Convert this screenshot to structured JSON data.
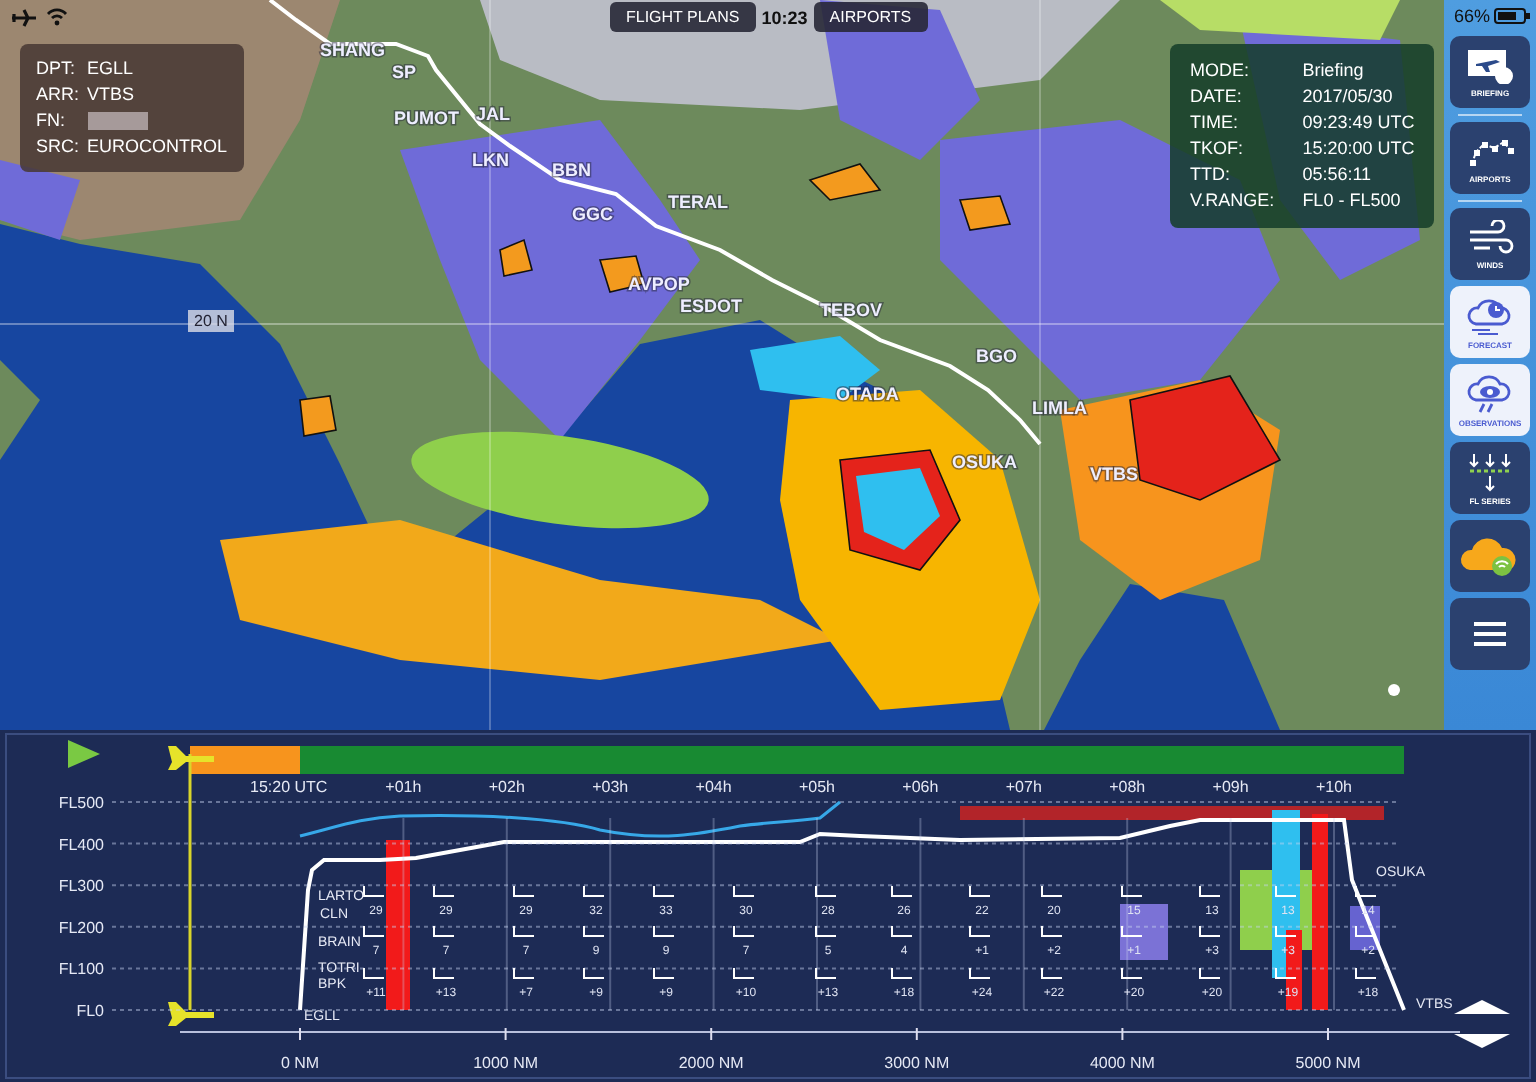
{
  "status_bar": {
    "time": "10:23",
    "battery": "66%"
  },
  "top_buttons": [
    {
      "label": "FLIGHT PLANS",
      "selected": false
    },
    {
      "label": "AIRPORTS",
      "selected": false
    }
  ],
  "flight_info": [
    {
      "label": "DPT:",
      "value": "EGLL"
    },
    {
      "label": "ARR:",
      "value": "VTBS"
    },
    {
      "label": "FN:",
      "redacted": true
    },
    {
      "label": "SRC:",
      "value": "EUROCONTROL"
    }
  ],
  "briefing_info": [
    {
      "label": "MODE:",
      "value": "Briefing"
    },
    {
      "label": "DATE:",
      "value": "2017/05/30"
    },
    {
      "label": "TIME:",
      "value": "09:23:49 UTC"
    },
    {
      "label": "TKOF:",
      "value": "15:20:00 UTC"
    },
    {
      "label": "TTD:",
      "value": "05:56:11"
    },
    {
      "label": "V.RANGE:",
      "value": "FL0 - FL500"
    }
  ],
  "map": {
    "latitude_label": "20 N",
    "waypoints": [
      "SHANG",
      "SP",
      "PUMOT",
      "JAL",
      "LKN",
      "BBN",
      "GGC",
      "TERAL",
      "AVPOP",
      "ESDOT",
      "TEBOV",
      "OTADA",
      "BGO",
      "LIMLA",
      "OSUKA",
      "VTBS"
    ]
  },
  "sidebar": {
    "items": [
      {
        "kind": "briefing",
        "label": "BRIEFING",
        "selected": false
      },
      {
        "kind": "airports",
        "label": "AIRPORTS",
        "selected": false
      },
      {
        "kind": "winds",
        "label": "WINDS",
        "selected": false
      },
      {
        "kind": "forecast",
        "label": "FORECAST",
        "selected": true
      },
      {
        "kind": "observations",
        "label": "OBSERVATIONS",
        "selected": true
      },
      {
        "kind": "levels",
        "label": "FL SERIES",
        "selected": false
      },
      {
        "kind": "cloud",
        "selected": false
      },
      {
        "kind": "menu",
        "selected": false
      }
    ]
  },
  "profile": {
    "time_labels": [
      "15:20 UTC",
      "+01h",
      "+02h",
      "+03h",
      "+04h",
      "+05h",
      "+06h",
      "+07h",
      "+08h",
      "+09h",
      "+10h"
    ],
    "level_labels": [
      "FL500",
      "FL400",
      "FL300",
      "FL200",
      "FL100",
      "FL0"
    ],
    "distance_labels": [
      "0 NM",
      "1000 NM",
      "2000 NM",
      "3000 NM",
      "4000 NM",
      "5000 NM"
    ],
    "waypoints": [
      "LARTO",
      "CLN",
      "BRAIN",
      "TOTRI",
      "BPK",
      "EGLL",
      "OSUKA",
      "VTBS"
    ],
    "temperature_columns": [
      {
        "upper": "29",
        "middle": "7",
        "lower": "+11"
      },
      {
        "upper": "29",
        "middle": "7",
        "lower": "+13"
      },
      {
        "upper": "29",
        "middle": "7",
        "lower": "+7"
      },
      {
        "upper": "32",
        "middle": "9",
        "lower": "+9"
      },
      {
        "upper": "33",
        "middle": "9",
        "lower": "+9"
      },
      {
        "upper": "30",
        "middle": "7",
        "lower": "+10"
      },
      {
        "upper": "28",
        "middle": "5",
        "lower": "+13"
      },
      {
        "upper": "26",
        "middle": "4",
        "lower": "+18"
      },
      {
        "upper": "22",
        "middle": "+1",
        "lower": "+24"
      },
      {
        "upper": "20",
        "middle": "+2",
        "lower": "+22"
      },
      {
        "upper": "15",
        "middle": "+1",
        "lower": "+20"
      },
      {
        "upper": "13",
        "middle": "+3",
        "lower": "+20"
      },
      {
        "upper": "13",
        "middle": "+3",
        "lower": "+19"
      },
      {
        "upper": "14",
        "middle": "+2",
        "lower": "+18"
      }
    ]
  }
}
